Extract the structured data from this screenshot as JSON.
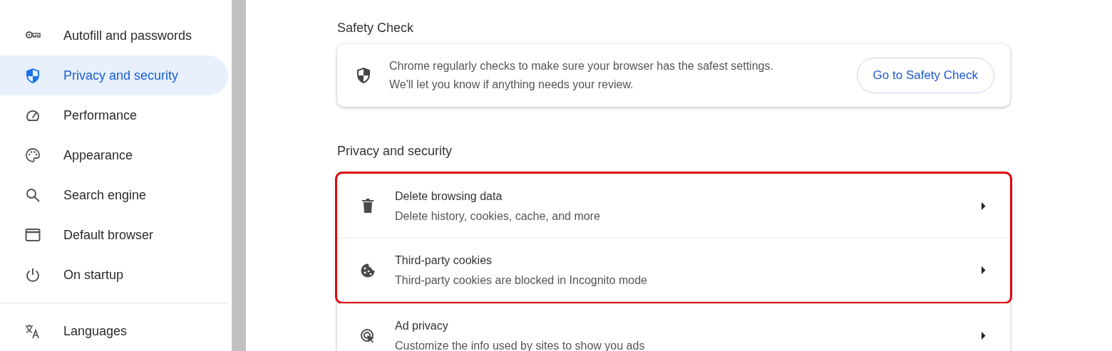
{
  "sidebar": {
    "groups": [
      {
        "items": [
          {
            "label": "Autofill and passwords",
            "kind": "key",
            "selected": false
          },
          {
            "label": "Privacy and security",
            "kind": "shield",
            "selected": true
          },
          {
            "label": "Performance",
            "kind": "gauge",
            "selected": false
          },
          {
            "label": "Appearance",
            "kind": "palette",
            "selected": false
          },
          {
            "label": "Search engine",
            "kind": "search",
            "selected": false
          },
          {
            "label": "Default browser",
            "kind": "browser",
            "selected": false
          },
          {
            "label": "On startup",
            "kind": "power",
            "selected": false
          }
        ]
      },
      {
        "items": [
          {
            "label": "Languages",
            "kind": "translate",
            "selected": false
          }
        ]
      }
    ]
  },
  "safety_check": {
    "heading": "Safety Check",
    "lines": [
      "Chrome regularly checks to make sure your browser has the safest settings.",
      "We'll let you know if anything needs your review."
    ],
    "button": "Go to Safety Check"
  },
  "privacy": {
    "heading": "Privacy and security",
    "rows": [
      {
        "title": "Delete browsing data",
        "subtitle": "Delete history, cookies, cache, and more",
        "kind": "trash",
        "highlighted": true
      },
      {
        "title": "Third-party cookies",
        "subtitle": "Third-party cookies are blocked in Incognito mode",
        "kind": "cookie",
        "highlighted": true
      },
      {
        "title": "Ad privacy",
        "subtitle": "Customize the info used by sites to show you ads",
        "kind": "ad",
        "highlighted": false
      }
    ]
  }
}
